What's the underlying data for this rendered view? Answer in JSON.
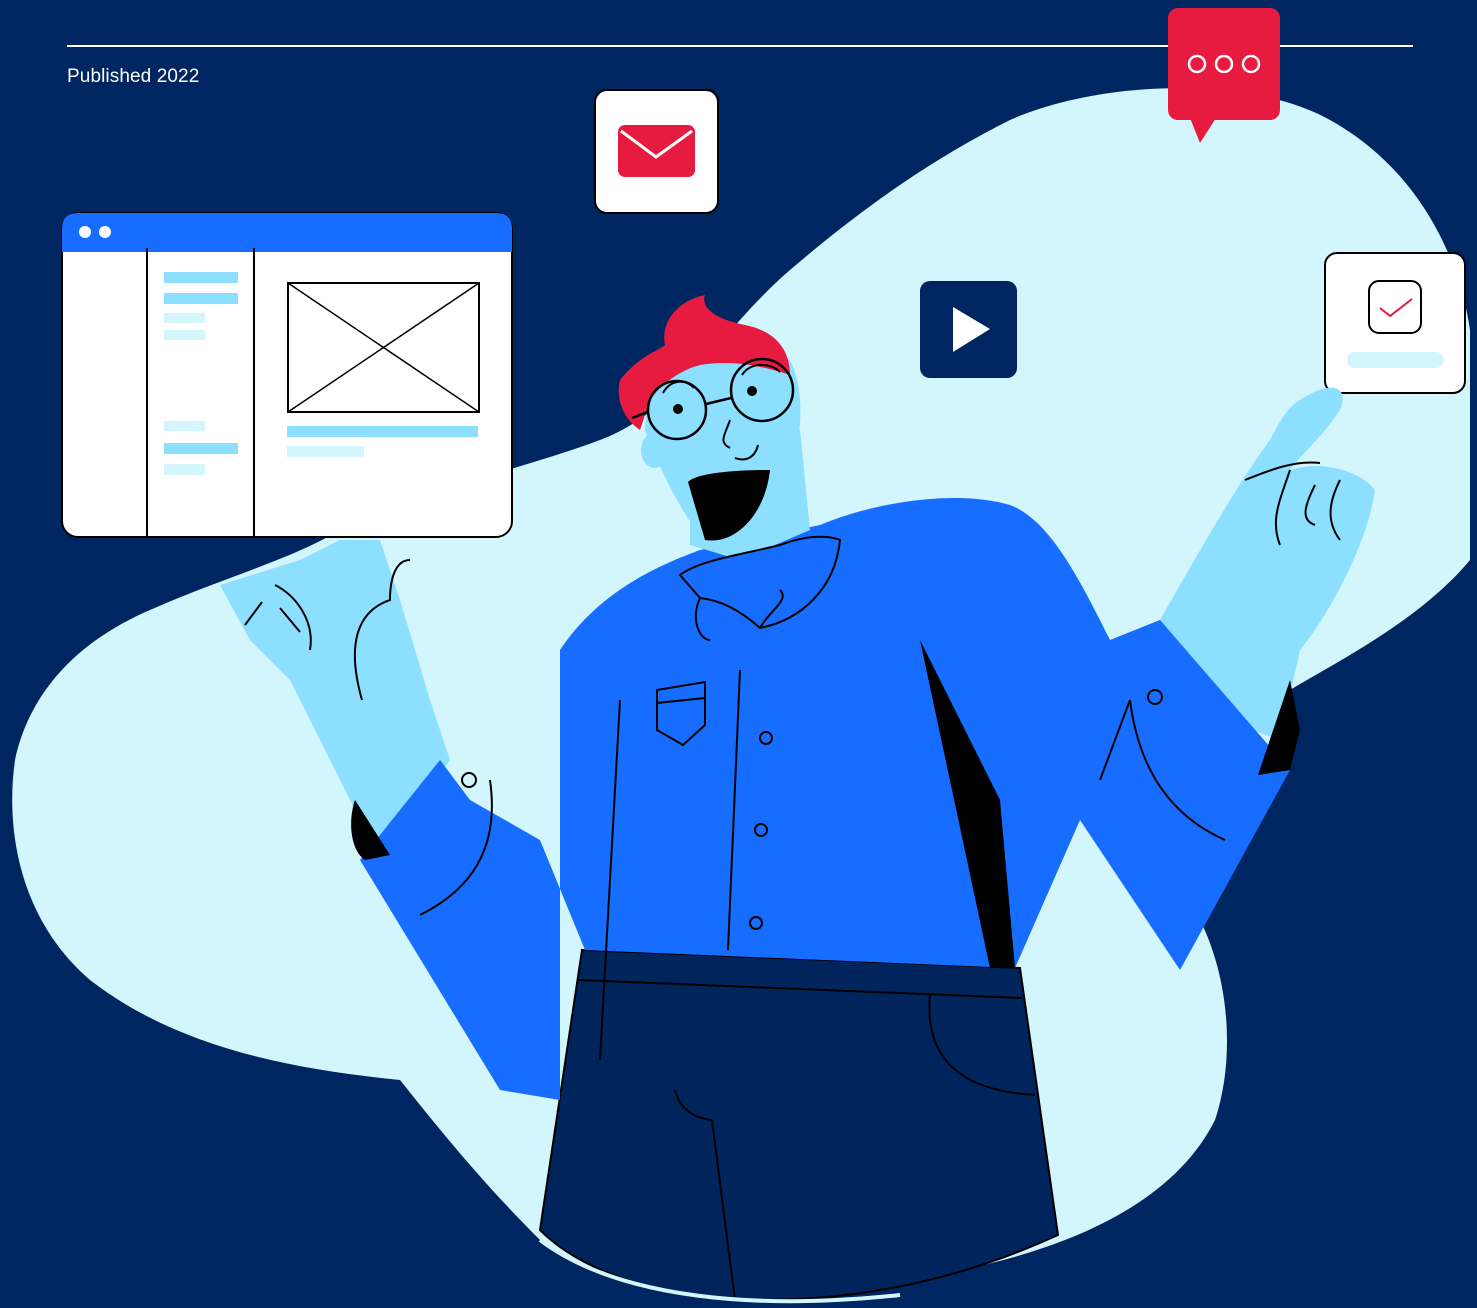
{
  "header": {
    "published_label": "Published 2022"
  },
  "illustration": {
    "icons": [
      "mail-icon",
      "chat-bubble-icon",
      "play-icon",
      "checkbox-icon",
      "browser-window-icon",
      "image-placeholder-icon"
    ]
  },
  "colors": {
    "background": "#002661",
    "blob": "#d3f5fc",
    "accent_red": "#e61b3f",
    "shirt_blue": "#166dff",
    "skin": "#8cdfff",
    "trousers": "#00245c",
    "white": "#ffffff"
  }
}
